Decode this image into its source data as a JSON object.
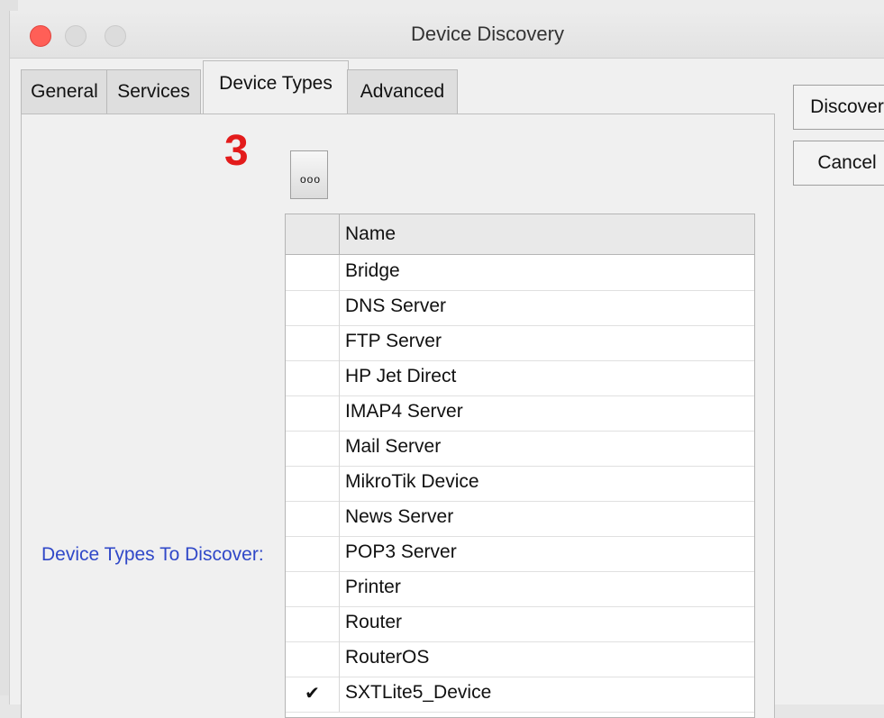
{
  "window": {
    "title": "Device Discovery"
  },
  "tabs": [
    {
      "label": "General"
    },
    {
      "label": "Services"
    },
    {
      "label": "Device Types"
    },
    {
      "label": "Advanced"
    }
  ],
  "annotation": {
    "number": "3",
    "color": "#e31b1b"
  },
  "panel": {
    "menu_button_label": "ooo",
    "field_label": "Device Types To Discover:",
    "table": {
      "header_name": "Name",
      "rows": [
        {
          "name": "Bridge",
          "check": ""
        },
        {
          "name": "DNS Server",
          "check": ""
        },
        {
          "name": "FTP Server",
          "check": ""
        },
        {
          "name": "HP Jet Direct",
          "check": ""
        },
        {
          "name": "IMAP4 Server",
          "check": ""
        },
        {
          "name": "Mail Server",
          "check": ""
        },
        {
          "name": "MikroTik Device",
          "check": ""
        },
        {
          "name": "News Server",
          "check": ""
        },
        {
          "name": "POP3 Server",
          "check": ""
        },
        {
          "name": "Printer",
          "check": ""
        },
        {
          "name": "Router",
          "check": ""
        },
        {
          "name": "RouterOS",
          "check": ""
        },
        {
          "name": "SXTLite5_Device",
          "check": "✔"
        }
      ]
    }
  },
  "buttons": {
    "discover": "Discover",
    "cancel": "Cancel"
  },
  "colors": {
    "label_blue": "#3048c8",
    "close_red": "#ff5f57"
  }
}
